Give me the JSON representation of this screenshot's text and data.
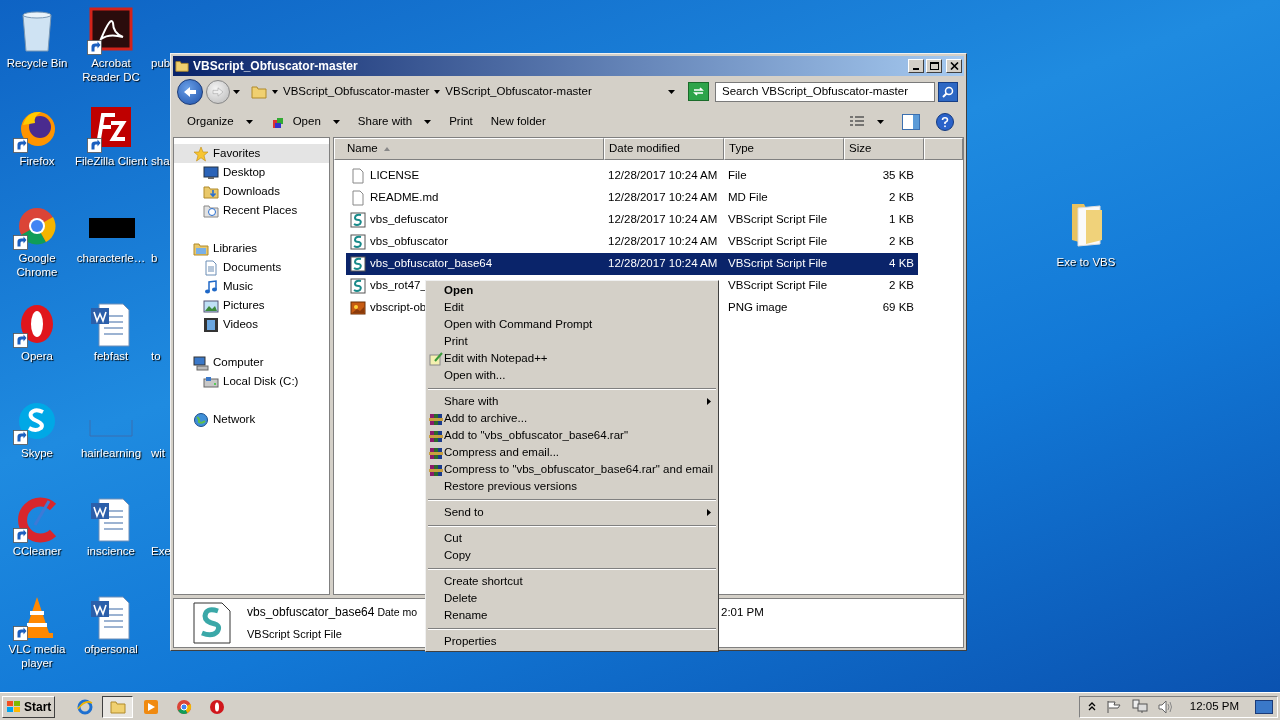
{
  "desktop_icons": [
    {
      "label": "Recycle Bin",
      "kind": "recycle",
      "shortcut": false
    },
    {
      "label": "Firefox",
      "kind": "firefox",
      "shortcut": true
    },
    {
      "label": "Google Chrome",
      "kind": "chrome",
      "shortcut": true
    },
    {
      "label": "Opera",
      "kind": "opera",
      "shortcut": true
    },
    {
      "label": "Skype",
      "kind": "skype",
      "shortcut": true
    },
    {
      "label": "CCleaner",
      "kind": "ccleaner",
      "shortcut": true
    },
    {
      "label": "VLC media player",
      "kind": "vlc",
      "shortcut": true
    },
    {
      "label": "Acrobat Reader DC",
      "kind": "acrobat",
      "shortcut": true
    },
    {
      "label": "FileZilla Client",
      "kind": "filezilla",
      "shortcut": true
    },
    {
      "label": "characterle…",
      "kind": "dark",
      "shortcut": false
    },
    {
      "label": "febfast",
      "kind": "word",
      "shortcut": false
    },
    {
      "label": "hairlearning",
      "kind": "blank",
      "shortcut": false
    },
    {
      "label": "inscience",
      "kind": "word",
      "shortcut": false
    },
    {
      "label": "ofpersonal",
      "kind": "word",
      "shortcut": false
    },
    {
      "label": "pub",
      "kind": "cut"
    },
    {
      "label": "sha",
      "kind": "cut"
    },
    {
      "label": "b",
      "kind": "cut"
    },
    {
      "label": "to",
      "kind": "cut"
    },
    {
      "label": "wit",
      "kind": "cut"
    },
    {
      "label": "Exe",
      "kind": "cut"
    }
  ],
  "desktop_folder": {
    "label": "Exe to VBS"
  },
  "window": {
    "title": "VBScript_Obfuscator-master",
    "address": {
      "crumbs": [
        "VBScript_Obfuscator-master",
        "VBScript_Obfuscator-master"
      ]
    },
    "search": {
      "placeholder": "Search VBScript_Obfuscator-master"
    },
    "toolbar": [
      {
        "label": "Organize",
        "kind": "menu"
      },
      {
        "label": "Open",
        "kind": "open"
      },
      {
        "label": "Share with",
        "kind": "menu"
      },
      {
        "label": "Print",
        "kind": "plain"
      },
      {
        "label": "New folder",
        "kind": "plain"
      }
    ],
    "nav": [
      {
        "label": "Favorites",
        "kind": "star",
        "selected": true,
        "children": [
          {
            "label": "Desktop",
            "kind": "desktop",
            "selected": false
          },
          {
            "label": "Downloads",
            "kind": "downloads",
            "selected": false
          },
          {
            "label": "Recent Places",
            "kind": "recent",
            "selected": false
          }
        ]
      },
      {
        "label": "Libraries",
        "kind": "library",
        "selected": false,
        "children": [
          {
            "label": "Documents",
            "kind": "documents",
            "selected": false
          },
          {
            "label": "Music",
            "kind": "music",
            "selected": false
          },
          {
            "label": "Pictures",
            "kind": "pictures",
            "selected": false
          },
          {
            "label": "Videos",
            "kind": "videos",
            "selected": false
          }
        ]
      },
      {
        "label": "Computer",
        "kind": "computer",
        "selected": false,
        "children": [
          {
            "label": "Local Disk (C:)",
            "kind": "disk",
            "selected": false
          }
        ]
      },
      {
        "label": "Network",
        "kind": "network",
        "selected": false
      }
    ],
    "columns": [
      {
        "label": "Name",
        "sorted": true
      },
      {
        "label": "Date modified",
        "sorted": false
      },
      {
        "label": "Type",
        "sorted": false
      },
      {
        "label": "Size",
        "sorted": false
      }
    ],
    "files": [
      {
        "name": "LICENSE",
        "date": "12/28/2017 10:24 AM",
        "type": "File",
        "size": "35 KB",
        "kind": "doc",
        "selected": false
      },
      {
        "name": "README.md",
        "date": "12/28/2017 10:24 AM",
        "type": "MD File",
        "size": "2 KB",
        "kind": "doc",
        "selected": false
      },
      {
        "name": "vbs_defuscator",
        "date": "12/28/2017 10:24 AM",
        "type": "VBScript Script File",
        "size": "1 KB",
        "kind": "script",
        "selected": false
      },
      {
        "name": "vbs_obfuscator",
        "date": "12/28/2017 10:24 AM",
        "type": "VBScript Script File",
        "size": "2 KB",
        "kind": "script",
        "selected": false
      },
      {
        "name": "vbs_obfuscator_base64",
        "date": "12/28/2017 10:24 AM",
        "type": "VBScript Script File",
        "size": "4 KB",
        "kind": "script",
        "selected": true
      },
      {
        "name": "vbs_rot47_",
        "type": "VBScript Script File",
        "size": "2 KB",
        "kind": "script",
        "selected": false
      },
      {
        "name": "vbscript-ob",
        "type": "PNG image",
        "size": "69 KB",
        "kind": "image",
        "selected": false
      }
    ],
    "details": {
      "name": "vbs_obfuscator_base64",
      "date_label": "Date mo",
      "type": "VBScript Script File",
      "time": "2:01 PM"
    }
  },
  "context_menu": [
    {
      "kind": "default",
      "label": "Open"
    },
    {
      "kind": "plain",
      "label": "Edit"
    },
    {
      "kind": "plain",
      "label": "Open with Command Prompt"
    },
    {
      "kind": "plain",
      "label": "Print"
    },
    {
      "kind": "notepad",
      "label": "Edit with Notepad++"
    },
    {
      "kind": "plain",
      "label": "Open with..."
    },
    {
      "kind": "separator"
    },
    {
      "kind": "submenu",
      "label": "Share with"
    },
    {
      "kind": "archive",
      "label": "Add to archive..."
    },
    {
      "kind": "archive",
      "label": "Add to \"vbs_obfuscator_base64.rar\""
    },
    {
      "kind": "archive",
      "label": "Compress and email..."
    },
    {
      "kind": "archive",
      "label": "Compress to \"vbs_obfuscator_base64.rar\" and email"
    },
    {
      "kind": "plain",
      "label": "Restore previous versions"
    },
    {
      "kind": "separator"
    },
    {
      "kind": "submenu",
      "label": "Send to"
    },
    {
      "kind": "separator"
    },
    {
      "kind": "plain",
      "label": "Cut"
    },
    {
      "kind": "plain",
      "label": "Copy"
    },
    {
      "kind": "separator"
    },
    {
      "kind": "plain",
      "label": "Create shortcut"
    },
    {
      "kind": "plain",
      "label": "Delete"
    },
    {
      "kind": "plain",
      "label": "Rename"
    },
    {
      "kind": "separator"
    },
    {
      "kind": "plain",
      "label": "Properties"
    }
  ],
  "taskbar": {
    "start": "Start",
    "apps": [
      {
        "kind": "ie",
        "selected": false
      },
      {
        "kind": "explorer",
        "selected": true
      },
      {
        "kind": "media",
        "selected": false
      },
      {
        "kind": "chrome",
        "selected": false
      },
      {
        "kind": "opera",
        "selected": false
      }
    ],
    "time": "12:05 PM"
  }
}
